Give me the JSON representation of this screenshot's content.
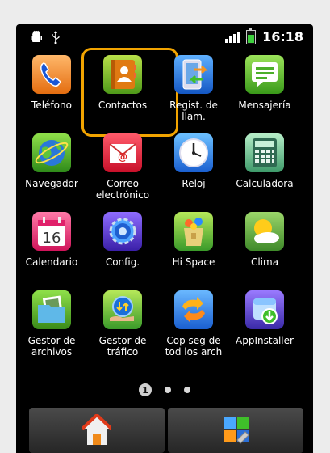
{
  "status": {
    "time": "16:18"
  },
  "apps": [
    {
      "label": "Teléfono",
      "icon": "phone-icon"
    },
    {
      "label": "Contactos",
      "icon": "contacts-icon"
    },
    {
      "label": "Regist. de llam.",
      "icon": "call-log-icon"
    },
    {
      "label": "Mensajería",
      "icon": "messaging-icon"
    },
    {
      "label": "Navegador",
      "icon": "browser-globe-icon"
    },
    {
      "label": "Correo electrónico",
      "icon": "email-icon"
    },
    {
      "label": "Reloj",
      "icon": "clock-icon"
    },
    {
      "label": "Calculadora",
      "icon": "calculator-icon"
    },
    {
      "label": "Calendario",
      "icon": "calendar-icon"
    },
    {
      "label": "Config.",
      "icon": "settings-gear-icon"
    },
    {
      "label": "Hi Space",
      "icon": "hi-space-icon"
    },
    {
      "label": "Clima",
      "icon": "weather-icon"
    },
    {
      "label": "Gestor de archivos",
      "icon": "file-manager-icon"
    },
    {
      "label": "Gestor de tráfico",
      "icon": "traffic-manager-icon"
    },
    {
      "label": "Cop seg de tod los arch",
      "icon": "backup-icon"
    },
    {
      "label": "AppInstaller",
      "icon": "app-installer-icon"
    }
  ],
  "calendar_day": "16",
  "pager": {
    "current": "1",
    "total_pages": 3
  },
  "colors": {
    "highlight": "#f2a400",
    "background": "#000000"
  }
}
